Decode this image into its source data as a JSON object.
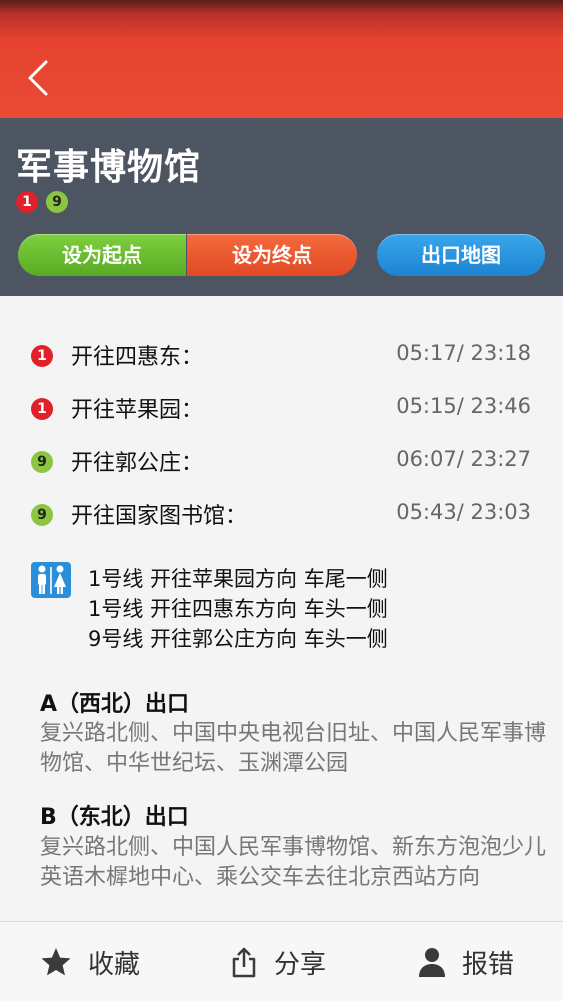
{
  "header": {
    "station_name": "军事博物馆",
    "lines": [
      {
        "number": "1",
        "color": "#e0202a"
      },
      {
        "number": "9",
        "color": "#8cc63f"
      }
    ],
    "buttons": {
      "set_start": "设为起点",
      "set_end": "设为终点",
      "exit_map": "出口地图"
    }
  },
  "schedule": [
    {
      "line": "1",
      "direction": "开往四惠东：",
      "time": "05:17/ 23:18"
    },
    {
      "line": "1",
      "direction": "开往苹果园：",
      "time": "05:15/ 23:46"
    },
    {
      "line": "9",
      "direction": "开往郭公庄：",
      "time": "06:07/ 23:27"
    },
    {
      "line": "9",
      "direction": "开往国家图书馆：",
      "time": "05:43/ 23:03"
    }
  ],
  "restroom": {
    "icon": "restroom-icon",
    "lines": [
      "1号线 开往苹果园方向 车尾一侧",
      "1号线 开往四惠东方向 车头一侧",
      "9号线 开往郭公庄方向 车头一侧"
    ]
  },
  "exits": [
    {
      "title": "A（西北）出口",
      "description": "复兴路北侧、中国中央电视台旧址、中国人民军事博物馆、中华世纪坛、玉渊潭公园"
    },
    {
      "title": "B（东北）出口",
      "description": "复兴路北侧、中国人民军事博物馆、新东方泡泡少儿英语木樨地中心、乘公交车去往北京西站方向"
    }
  ],
  "bottom_bar": {
    "favorite": {
      "label": "收藏",
      "icon": "star-icon"
    },
    "share": {
      "label": "分享",
      "icon": "share-icon"
    },
    "report": {
      "label": "报错",
      "icon": "user-icon"
    }
  },
  "colors": {
    "top_bar": "#e94a35",
    "header_bg": "#4d5563",
    "start_button": "#6cbd30",
    "end_button": "#ee5a30",
    "map_button": "#2a95e0"
  }
}
